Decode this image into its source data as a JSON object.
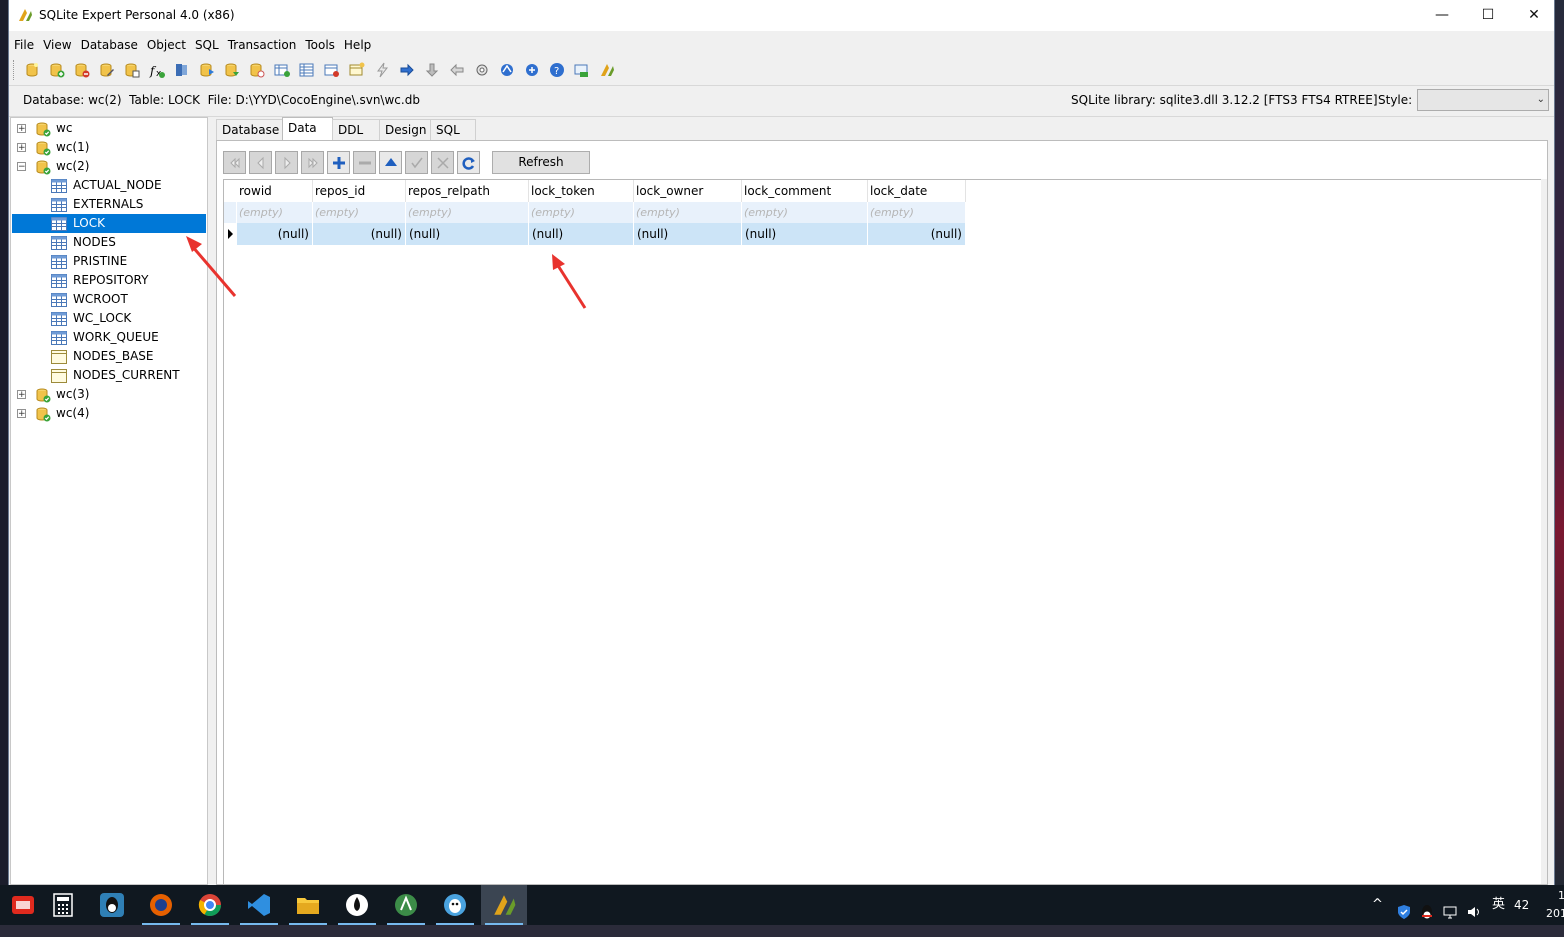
{
  "window": {
    "title": "SQLite Expert Personal 4.0 (x86)",
    "controls": {
      "minimize": "—",
      "maximize": "☐",
      "close": "✕"
    }
  },
  "menu": [
    "File",
    "View",
    "Database",
    "Object",
    "SQL",
    "Transaction",
    "Tools",
    "Help"
  ],
  "toolbar_icons": [
    "new-database-icon",
    "attach-database-icon",
    "detach-database-icon",
    "edit-icon",
    "new-table-icon",
    "new-function-icon",
    "backup-icon",
    "import-icon",
    "export-icon",
    "sql-icon",
    "new-index-icon",
    "table-design-icon",
    "new-view-icon",
    "new-trigger-icon",
    "move-right-icon",
    "move-down-icon",
    "move-left-icon",
    "settings-icon",
    "tools-icon",
    "connect-icon",
    "help-icon",
    "vacuum-icon",
    "about-icon"
  ],
  "info": {
    "left": "Database: wc(2)  Table: LOCK  File: D:\\YYD\\CocoEngine\\.svn\\wc.db",
    "library": "SQLite library: sqlite3.dll 3.12.2 [FTS3 FTS4 RTREE]",
    "style_label": "Style:",
    "style_value": ""
  },
  "tree": {
    "databases_before": [
      "wc",
      "wc(1)"
    ],
    "open_database": "wc(2)",
    "tables": [
      "ACTUAL_NODE",
      "EXTERNALS",
      "LOCK",
      "NODES",
      "PRISTINE",
      "REPOSITORY",
      "WCROOT",
      "WC_LOCK",
      "WORK_QUEUE"
    ],
    "views": [
      "NODES_BASE",
      "NODES_CURRENT"
    ],
    "databases_after": [
      "wc(3)",
      "wc(4)"
    ],
    "selected": "LOCK"
  },
  "tabs": [
    "Database",
    "Data",
    "DDL",
    "Design",
    "SQL"
  ],
  "active_tab": "Data",
  "data_toolbar": {
    "buttons": [
      "first-record-icon",
      "prior-record-icon",
      "next-record-icon",
      "last-record-icon",
      "add-record-icon",
      "delete-record-icon",
      "move-up-icon",
      "post-edit-icon",
      "cancel-edit-icon",
      "refresh-data-icon"
    ],
    "refresh_label": "Refresh"
  },
  "grid": {
    "columns": [
      "rowid",
      "repos_id",
      "repos_relpath",
      "lock_token",
      "lock_owner",
      "lock_comment",
      "lock_date"
    ],
    "filter_placeholder": "(empty)",
    "rows": [
      [
        "(null)",
        "(null)",
        "(null)",
        "(null)",
        "(null)",
        "(null)",
        "(null)"
      ]
    ]
  },
  "annotation_color": "#e8332e",
  "taskbar": {
    "apps": [
      "youdao-dict-icon",
      "calculator-icon",
      "qq-icon",
      "firefox-icon",
      "chrome-icon",
      "visual-studio-icon",
      "file-explorer-icon",
      "inkscape-icon",
      "android-studio-icon",
      "qq-tim-icon",
      "sqlite-expert-icon"
    ],
    "tray": {
      "chevron": "^",
      "ime": "英",
      "temp": "42",
      "clock": "1",
      "clock2": "201"
    }
  }
}
